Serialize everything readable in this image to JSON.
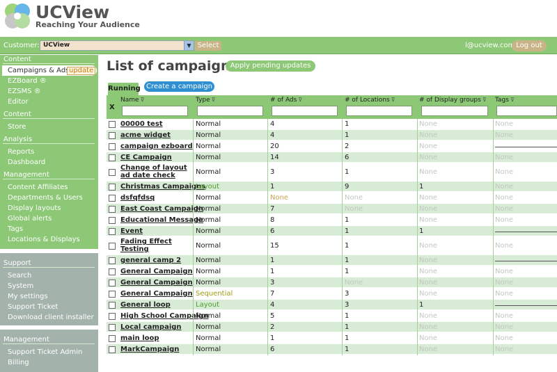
{
  "header": {
    "brand": "UCView",
    "tagline": "Reaching Your Audience"
  },
  "customer_bar": {
    "label": "Customer:",
    "selected": "UCView",
    "select_button": "Select",
    "user_email": "l@ucview.com",
    "logout_label": "Log out"
  },
  "sidebar": {
    "content_head": "Content",
    "campaigns_label": "Campaigns & Ads",
    "update_label": "update",
    "ezboard": "EZBoard ®",
    "ezsms": "EZSMS ®",
    "editor": "Editor",
    "content_head2": "Content",
    "store": "Store",
    "analysis_head": "Analysis",
    "reports": "Reports",
    "dashboard": "Dashboard",
    "management_head": "Management",
    "content_affiliates": "Content Affiliates",
    "departments_users": "Departments & Users",
    "display_layouts": "Display layouts",
    "global_alerts": "Global alerts",
    "tags": "Tags",
    "locations_displays": "Locations & Displays",
    "support_head": "Support",
    "search": "Search",
    "system": "System",
    "my_settings": "My settings",
    "support_ticket": "Support Ticket",
    "download_installer": "Download client installer",
    "management_head2": "Management",
    "support_ticket_admin": "Support Ticket Admin",
    "billing": "Billing"
  },
  "main": {
    "title": "List of campaigns",
    "apply_label": "Apply pending updates",
    "tab_running": "Running",
    "create_label": "Create a campaign"
  },
  "table": {
    "x_label": "X",
    "columns": [
      "Name",
      "Type",
      "# of Ads",
      "# of Locations",
      "# of Display groups",
      "Tags"
    ],
    "rows": [
      {
        "name": "00000 test",
        "type": "Normal",
        "ads": "4",
        "loc": "1",
        "dg": "None",
        "tags": "None"
      },
      {
        "name": "acme widget",
        "type": "Normal",
        "ads": "4",
        "loc": "1",
        "dg": "None",
        "tags": "None"
      },
      {
        "name": "campaign ezboard",
        "type": "Normal",
        "ads": "20",
        "loc": "2",
        "dg": "None",
        "tags": ""
      },
      {
        "name": "CE Campaign",
        "type": "Normal",
        "ads": "14",
        "loc": "6",
        "dg": "None",
        "tags": "None"
      },
      {
        "name": "Change of layout ad date check",
        "type": "Normal",
        "ads": "3",
        "loc": "1",
        "dg": "None",
        "tags": "None"
      },
      {
        "name": "Christmas Campaigns",
        "type": "Layout",
        "ads": "1",
        "loc": "9",
        "dg": "1",
        "tags": "None"
      },
      {
        "name": "dsfqfdsq",
        "type": "Normal",
        "ads": "None",
        "loc": "None",
        "dg": "None",
        "tags": "None"
      },
      {
        "name": "East Coast Campaign",
        "type": "Normal",
        "ads": "7",
        "loc": "None",
        "dg": "None",
        "tags": "None"
      },
      {
        "name": "Educational Message",
        "type": "Normal",
        "ads": "8",
        "loc": "1",
        "dg": "None",
        "tags": "None"
      },
      {
        "name": "Event",
        "type": "Normal",
        "ads": "6",
        "loc": "1",
        "dg": "1",
        "tags": ""
      },
      {
        "name": "Fading Effect Testing",
        "type": "Normal",
        "ads": "15",
        "loc": "1",
        "dg": "None",
        "tags": "None"
      },
      {
        "name": "general camp 2",
        "type": "Normal",
        "ads": "1",
        "loc": "1",
        "dg": "None",
        "tags": ""
      },
      {
        "name": "General Campaign",
        "type": "Normal",
        "ads": "1",
        "loc": "1",
        "dg": "None",
        "tags": "None"
      },
      {
        "name": "General Campaign",
        "type": "Normal",
        "ads": "3",
        "loc": "None",
        "dg": "None",
        "tags": "None"
      },
      {
        "name": "General Campaign",
        "type": "Sequential",
        "ads": "7",
        "loc": "3",
        "dg": "None",
        "tags": "None"
      },
      {
        "name": "General loop",
        "type": "Layout",
        "ads": "4",
        "loc": "3",
        "dg": "1",
        "tags": ""
      },
      {
        "name": "High School Campaign",
        "type": "Normal",
        "ads": "5",
        "loc": "1",
        "dg": "None",
        "tags": "None"
      },
      {
        "name": "Local campaign",
        "type": "Normal",
        "ads": "2",
        "loc": "1",
        "dg": "None",
        "tags": "None"
      },
      {
        "name": "main loop",
        "type": "Normal",
        "ads": "1",
        "loc": "1",
        "dg": "None",
        "tags": "None"
      },
      {
        "name": "MarkCampaign",
        "type": "Normal",
        "ads": "6",
        "loc": "1",
        "dg": "None",
        "tags": "None"
      }
    ]
  },
  "colors": {
    "brand_green": "#8cc876",
    "sidebar_gray": "#a4b2ac",
    "create_blue": "#2f8fd0",
    "row_alt": "#d8ebd6"
  },
  "icons": [
    "ucview-logo-icon",
    "chevron-down-icon",
    "filter-icon",
    "checkbox-icon"
  ]
}
